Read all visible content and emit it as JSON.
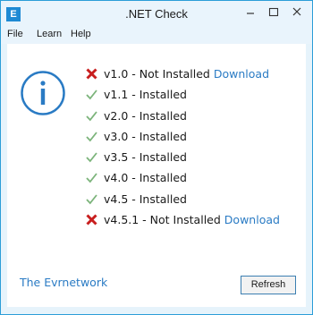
{
  "window": {
    "title": ".NET Check",
    "app_icon_letter": "E",
    "controls": {
      "minimize": "—",
      "maximize": "☐",
      "close": "✕"
    }
  },
  "menu": [
    "File",
    "Learn",
    "Help"
  ],
  "colors": {
    "accent": "#2b9dd8",
    "installed": "#7cb47b",
    "not_installed": "#c81e1e",
    "link": "#2a7bc4"
  },
  "info_icon": "info-circle-icon",
  "statuses": [
    {
      "text": "v1.0 - Not Installed",
      "installed": false,
      "link": "Download"
    },
    {
      "text": "v1.1 - Installed",
      "installed": true,
      "link": ""
    },
    {
      "text": "v2.0 - Installed",
      "installed": true,
      "link": ""
    },
    {
      "text": "v3.0 - Installed",
      "installed": true,
      "link": ""
    },
    {
      "text": "v3.5 - Installed",
      "installed": true,
      "link": ""
    },
    {
      "text": "v4.0 - Installed",
      "installed": true,
      "link": ""
    },
    {
      "text": "v4.5 - Installed",
      "installed": true,
      "link": ""
    },
    {
      "text": "v4.5.1 - Not Installed",
      "installed": false,
      "link": "Download"
    }
  ],
  "footer": {
    "link_text": "The Evrnetwork",
    "refresh_label": "Refresh"
  }
}
